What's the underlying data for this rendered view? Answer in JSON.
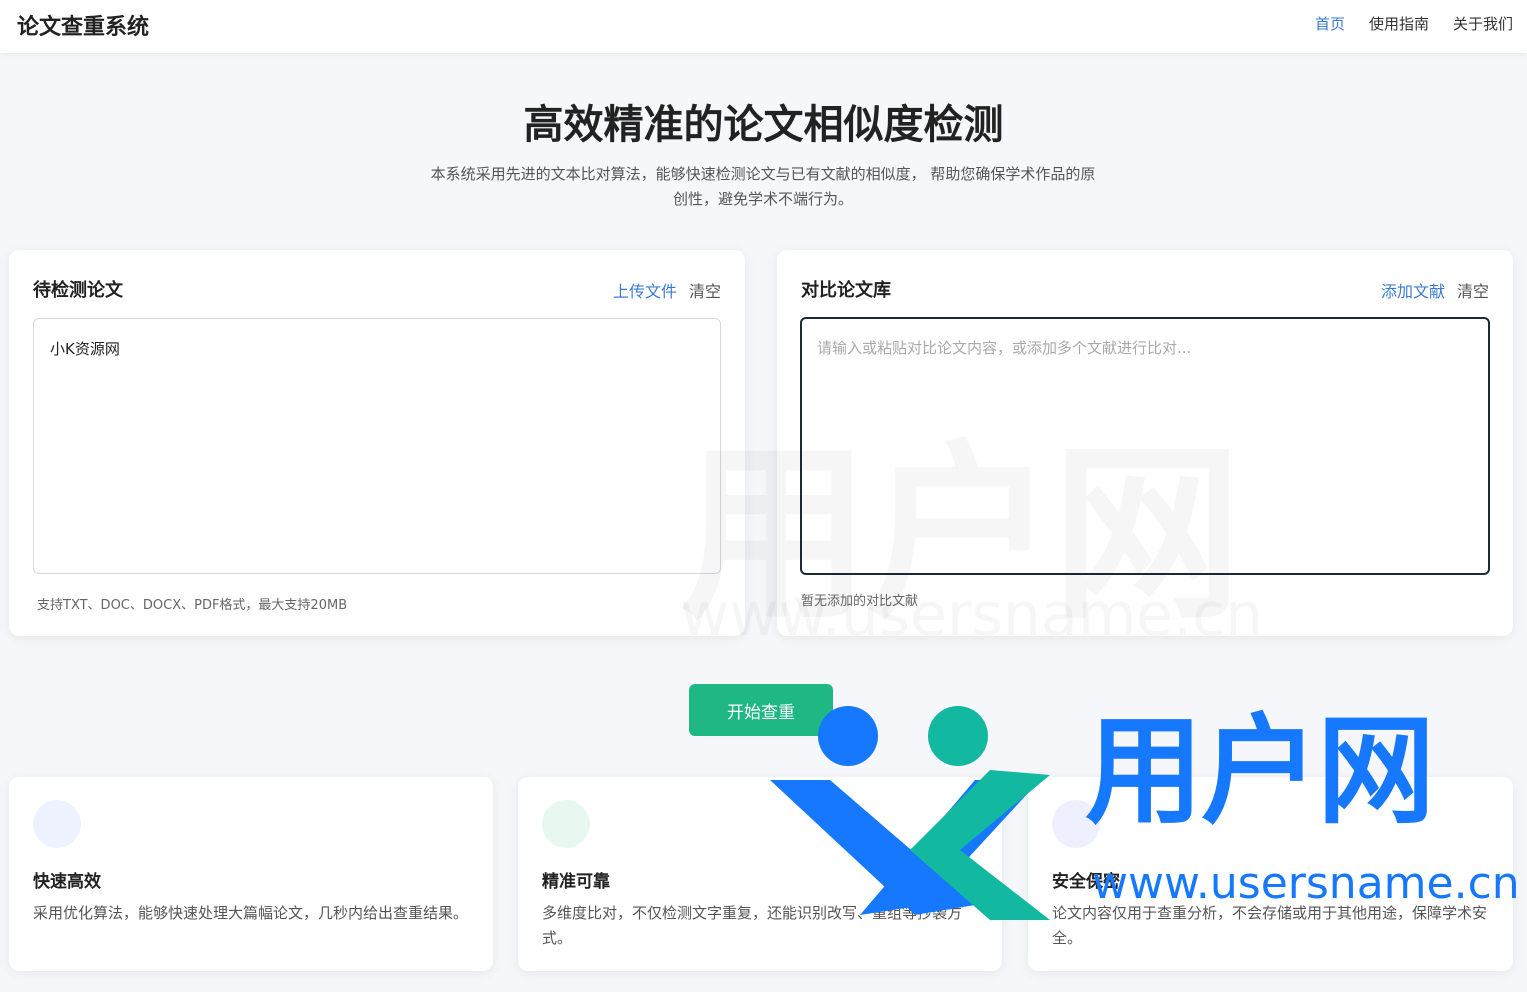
{
  "header": {
    "brand": "论文查重系统",
    "nav": [
      {
        "label": "首页",
        "active": true
      },
      {
        "label": "使用指南",
        "active": false
      },
      {
        "label": "关于我们",
        "active": false
      }
    ]
  },
  "hero": {
    "title": "高效精准的论文相似度检测",
    "subtitle": "本系统采用先进的文本比对算法，能够快速检测论文与已有文献的相似度， 帮助您确保学术作品的原创性，避免学术不端行为。"
  },
  "left_panel": {
    "title": "待检测论文",
    "upload_label": "上传文件",
    "clear_label": "清空",
    "content": "小K资源网",
    "hint": "支持TXT、DOC、DOCX、PDF格式，最大支持20MB"
  },
  "right_panel": {
    "title": "对比论文库",
    "add_label": "添加文献",
    "clear_label": "清空",
    "placeholder": "请输入或粘贴对比论文内容，或添加多个文献进行比对...",
    "hint": "暂无添加的对比文献"
  },
  "start_button": "开始查重",
  "features": [
    {
      "title": "快速高效",
      "desc": "采用优化算法，能够快速处理大篇幅论文，几秒内给出查重结果。",
      "icon": "lightning-icon",
      "color": "#eef2ff"
    },
    {
      "title": "精准可靠",
      "desc": "多维度比对，不仅检测文字重复，还能识别改写、重组等抄袭方式。",
      "icon": "check-icon",
      "color": "#e8f8f1"
    },
    {
      "title": "安全保密",
      "desc": "论文内容仅用于查重分析，不会存储或用于其他用途，保障学术安全。",
      "icon": "lock-icon",
      "color": "#eef0ff"
    }
  ],
  "watermark": {
    "text": "用户网",
    "url": "www.usersname.cn"
  },
  "colors": {
    "accent": "#3a7bd5",
    "start": "#1fb884",
    "watermark_blue": "#1677ff",
    "watermark_teal": "#12b8a0"
  }
}
